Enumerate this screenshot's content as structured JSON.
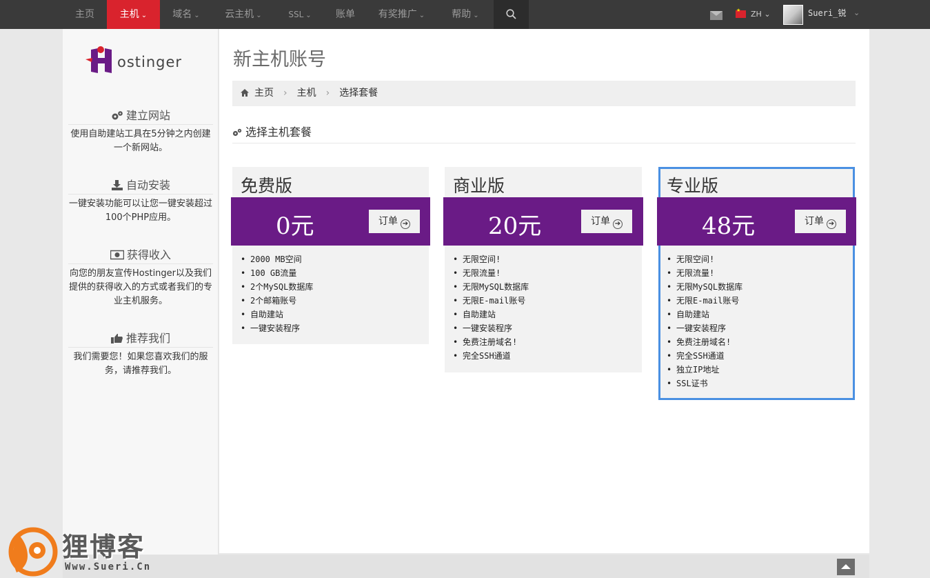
{
  "topnav": {
    "items": [
      {
        "label": "主页"
      },
      {
        "label": "主机",
        "active": true
      },
      {
        "label": "域名"
      },
      {
        "label": "云主机"
      },
      {
        "label": "SSL"
      },
      {
        "label": "账单"
      },
      {
        "label": "有奖推广"
      },
      {
        "label": "帮助"
      }
    ],
    "lang": "ZH",
    "username": "Sueri_锐",
    "active_color": "#d9232d"
  },
  "sidebar": {
    "logo_text": "ostinger",
    "sections": [
      {
        "title": "建立网站",
        "icon": "cogs-icon",
        "desc": "使用自助建站工具在5分钟之内创建一个新网站。"
      },
      {
        "title": "自动安装",
        "icon": "download-icon",
        "desc": "一键安装功能可以让您一键安装超过100个PHP应用。"
      },
      {
        "title": "获得收入",
        "icon": "money-icon",
        "desc": "向您的朋友宣传Hostinger以及我们提供的获得收入的方式或者我们的专业主机服务。"
      },
      {
        "title": "推荐我们",
        "icon": "thumbs-up-icon",
        "desc": "我们需要您！如果您喜欢我们的服务，请推荐我们。"
      }
    ]
  },
  "main": {
    "title": "新主机账号",
    "breadcrumb": [
      "主页",
      "主机",
      "选择套餐"
    ],
    "section_title": "选择主机套餐",
    "accent_color": "#6a1b86",
    "highlight_color": "#4a90e2",
    "order_label": "订单",
    "plans": [
      {
        "name": "免费版",
        "price": "0元",
        "features": [
          "2000 MB空间",
          "100 GB流量",
          "2个MySQL数据库",
          "2个邮箱账号",
          "自助建站",
          "一键安装程序"
        ]
      },
      {
        "name": "商业版",
        "price": "20元",
        "features": [
          "无限空间!",
          "无限流量!",
          "无限MySQL数据库",
          "无限E-mail账号",
          "自助建站",
          "一键安装程序",
          "免费注册域名!",
          "完全SSH通道"
        ]
      },
      {
        "name": "专业版",
        "price": "48元",
        "features": [
          "无限空间!",
          "无限流量!",
          "无限MySQL数据库",
          "无限E-mail账号",
          "自助建站",
          "一键安装程序",
          "免费注册域名!",
          "完全SSH通道",
          "独立IP地址",
          "SSL证书"
        ]
      }
    ]
  },
  "watermark": {
    "title": "狸博客",
    "url": "Www.Sueri.Cn"
  }
}
